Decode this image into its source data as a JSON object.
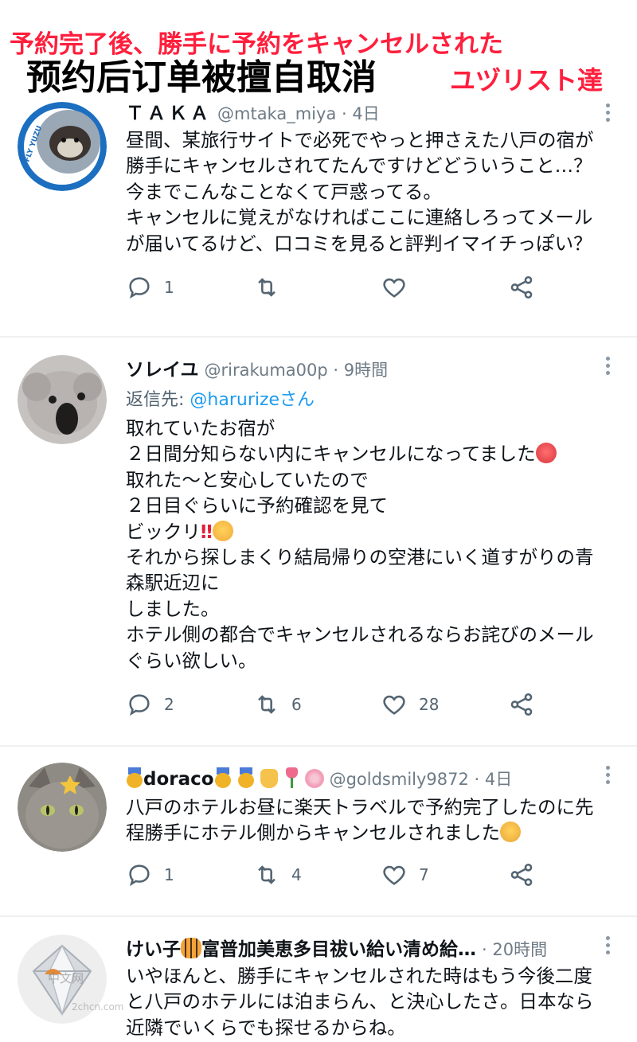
{
  "banner": {
    "jp_line1": "予約完了後、勝手に予約をキャンセルされた",
    "cn_title": "预约后订单被擅自取消",
    "jp_line2": "ユヅリスト達"
  },
  "tweets": [
    {
      "name": "ＴＡＫＡ",
      "handle": "@mtaka_miya · 4日",
      "lines": [
        "昼間、某旅行サイトで必死でやっと押さえた八戸の宿が",
        "勝手にキャンセルされてたんですけどどういうこと…？",
        "今までこんなことなくて戸惑ってる。",
        "キャンセルに覚えがなければここに連絡しろってメール",
        "が届いてるけど、口コミを見ると評判イマイチっぽい？"
      ],
      "reply_count": "1",
      "retweet_count": "",
      "like_count": "",
      "avatar_text": "FLY YUZU"
    },
    {
      "name": "ソレイユ",
      "handle": "@rirakuma00p · 9時間",
      "reply_prefix": "返信先: ",
      "reply_target": "@harurizeさん",
      "lines": [
        "取れていたお宿が",
        "２日間分知らない内にキャンセルになってました",
        "取れた〜と安心していたので",
        "２日目ぐらいに予約確認を見て",
        "ビックリ",
        "それから探しまくり結局帰りの空港にいく道すがりの青",
        "森駅近辺に",
        "しました。",
        "ホテル側の都合でキャンセルされるならお詫びのメール",
        "ぐらい欲しい。"
      ],
      "bang": "‼",
      "reply_count": "2",
      "retweet_count": "6",
      "like_count": "28"
    },
    {
      "name": "doraco",
      "handle": "@goldsmily9872 · 4日",
      "lines": [
        "八戸のホテルお昼に楽天トラベルで予約完了したのに先",
        "程勝手にホテル側からキャンセルされました"
      ],
      "reply_count": "1",
      "retweet_count": "4",
      "like_count": "7"
    },
    {
      "name_part1": "けい子",
      "name_part2": "富普加美恵多目祓い給い清め給…",
      "handle": "· 20時間",
      "lines": [
        "いやほんと、勝手にキャンセルされた時はもう今後二度",
        "と八戸のホテルには泊まらん、と決心したさ。日本なら",
        "近隣でいくらでも探せるからね。"
      ]
    }
  ],
  "watermark": "中文网",
  "watermark_url": "2chcn.com",
  "icons": [
    "reply-icon",
    "retweet-icon",
    "like-icon",
    "share-icon",
    "more-icon"
  ],
  "colors": {
    "accent": "#1d9bf0",
    "banner_red": "#ff1f3d",
    "icon_gray": "#536471"
  }
}
